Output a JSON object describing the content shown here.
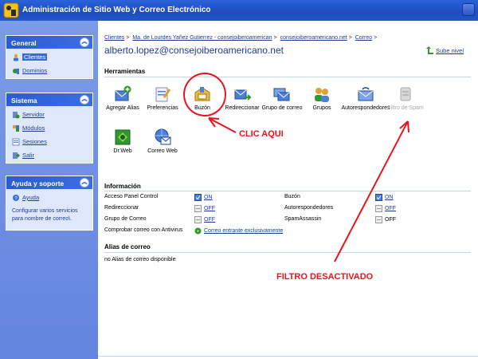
{
  "app": {
    "title": "Administración de Sitio Web y Correo Electrónico"
  },
  "sidebar": {
    "general": {
      "header": "General",
      "items": [
        {
          "label": "Clientes",
          "icon": "users-icon"
        },
        {
          "label": "Dominios",
          "icon": "domains-icon"
        }
      ]
    },
    "sistema": {
      "header": "Sistema",
      "items": [
        {
          "label": "Servidor",
          "icon": "server-icon"
        },
        {
          "label": "Módulos",
          "icon": "modules-icon"
        },
        {
          "label": "Sesiones",
          "icon": "sessions-icon"
        },
        {
          "label": "Salir",
          "icon": "exit-icon"
        }
      ]
    },
    "ayuda": {
      "header": "Ayuda y soporte",
      "items": [
        {
          "label": "Ayuda",
          "icon": "help-icon"
        }
      ],
      "description": "Configurar varios servicios para nombre de correo\\."
    }
  },
  "breadcrumb": {
    "items": [
      "Clientes",
      "Ma. de Lourdes Yañez Gutierrez - consejoiberoamerican",
      "consejoiberoamericano.net",
      "Correo"
    ],
    "separator": ">"
  },
  "page": {
    "title": "alberto.lopez@consejoiberoamericano.net",
    "up_level": "Sube nivel"
  },
  "tools": {
    "header": "Herramientas",
    "items": [
      {
        "label": "Agregar Alias",
        "icon": "add-alias-icon"
      },
      {
        "label": "Preferencias",
        "icon": "preferences-icon"
      },
      {
        "label": "Buzón",
        "icon": "mailbox-icon"
      },
      {
        "label": "Redireccionar",
        "icon": "redirect-icon"
      },
      {
        "label": "Grupo de correo",
        "icon": "mail-group-icon"
      },
      {
        "label": "Grupos",
        "icon": "groups-icon"
      },
      {
        "label": "Autorespondedores",
        "icon": "autoresponder-icon"
      },
      {
        "label": "Filtro de Spam",
        "icon": "spam-filter-icon"
      },
      {
        "label": "Dr.Web",
        "icon": "drweb-icon"
      },
      {
        "label": "Correo Web",
        "icon": "webmail-icon"
      }
    ]
  },
  "info": {
    "header": "Información",
    "left": [
      {
        "label": "Acceso Panel Control",
        "value": "ON"
      },
      {
        "label": "Redireccionar",
        "value": "OFF"
      },
      {
        "label": "Grupo de Correo",
        "value": "OFF"
      },
      {
        "label": "Comprobar correo con Antivirus",
        "value": "Correo entrante exclusivamente"
      }
    ],
    "right": [
      {
        "label": "Buzón",
        "value": "ON"
      },
      {
        "label": "Autorespondedores",
        "value": "OFF"
      },
      {
        "label": "SpamAssassin",
        "value": "OFF"
      }
    ]
  },
  "aliases": {
    "header": "Alias de correo",
    "empty": "no Alias de correo disponible"
  },
  "annotations": {
    "click_here": "CLIC AQUI",
    "filter_off": "FILTRO DESACTIVADO"
  },
  "colors": {
    "accent": "#1c3b9c",
    "title_bar": "#1d4cc0",
    "sidebar": "#6f8fe2",
    "annotation": "#e8141b"
  }
}
